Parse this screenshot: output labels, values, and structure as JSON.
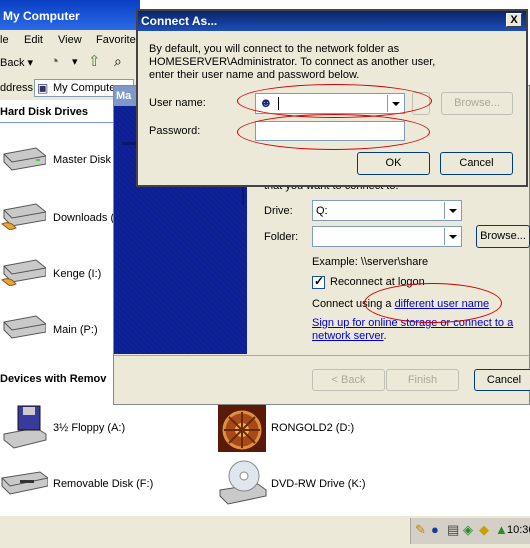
{
  "explorer": {
    "title": "My Computer",
    "menu": [
      "le",
      "Edit",
      "View",
      "Favorite"
    ],
    "toolbar": {
      "back_label": "Back"
    },
    "address": {
      "label": "ddress",
      "value": "My Compute"
    },
    "sections": {
      "hard_disks": "Hard Disk Drives",
      "removable": "Devices with Remov"
    },
    "hard_disks": [
      "Master Disk",
      "Downloads (",
      "Kenge (I:)",
      "Main (P:)"
    ],
    "devices": [
      {
        "label": "3½ Floppy (A:)",
        "icon": "floppy-icon"
      },
      {
        "label": "RONGOLD2 (D:)",
        "icon": "game-disc-icon"
      },
      {
        "label": "Removable Disk (F:)",
        "icon": "removable-disk-icon"
      },
      {
        "label": "DVD-RW Drive (K:)",
        "icon": "dvd-drive-icon"
      }
    ]
  },
  "wizard": {
    "title": "Ma",
    "intro_tail": "that you want to connect to:",
    "drive_label": "Drive:",
    "drive_value": "Q:",
    "folder_label": "Folder:",
    "folder_value": "",
    "browse_label": "Browse...",
    "example": "Example: \\\\server\\share",
    "reconnect_label": "Reconnect at logon",
    "reconnect_checked": true,
    "connect_using_prefix": "Connect using a ",
    "different_user_link": "different user name",
    "signup_link_1": "Sign up for online storage or connect to a",
    "signup_link_2": "network server",
    "buttons": {
      "back": "< Back",
      "finish": "Finish",
      "cancel": "Cancel"
    }
  },
  "dialog": {
    "title": "Connect As...",
    "description_1": "By default, you will connect to the network folder as",
    "description_2": "HOMESERVER\\Administrator. To connect as another user,",
    "description_3": "enter their user name and password below.",
    "username_label": "User name:",
    "username_value": "",
    "password_label": "Password:",
    "password_value": "",
    "browse_label": "Browse...",
    "ok_label": "OK",
    "cancel_label": "Cancel",
    "close_symbol": "X"
  },
  "taskbar": {
    "clock": "10:36"
  },
  "colors": {
    "annotation": "#d00000",
    "title_active": "#0a246a",
    "link": "#0000cc"
  }
}
